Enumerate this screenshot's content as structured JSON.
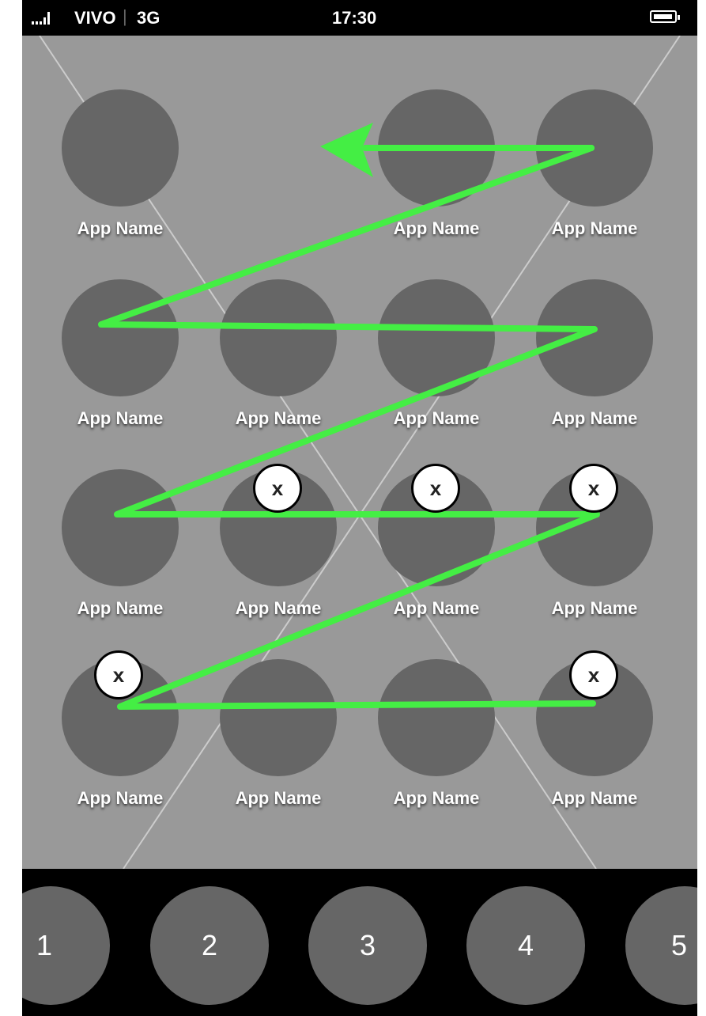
{
  "status_bar": {
    "carrier": "VIVO",
    "separator": "|",
    "network": "3G",
    "time": "17:30"
  },
  "apps": [
    {
      "label": "App Name"
    },
    {
      "label": "App Name"
    },
    {
      "label": "App Name"
    },
    {
      "label": "App Name"
    },
    {
      "label": "App Name"
    },
    {
      "label": "App Name"
    },
    {
      "label": "App Name"
    },
    {
      "label": "App Name"
    },
    {
      "label": "App Name"
    },
    {
      "label": "App Name"
    },
    {
      "label": "App Name"
    },
    {
      "label": "App Name"
    },
    {
      "label": "App Name"
    },
    {
      "label": "App Name"
    },
    {
      "label": "App Name"
    }
  ],
  "delete_badge_label": "x",
  "dock": {
    "pages": [
      "1",
      "2",
      "3",
      "4",
      "5"
    ]
  },
  "colors": {
    "background": "#999999",
    "icon": "#666666",
    "dock": "#000000",
    "gesture_path": "#44ee44",
    "badge": "#ffffff"
  },
  "icons": {
    "signal": "signal-strength-icon",
    "battery": "battery-icon",
    "gesture": "swipe-path-arrow-icon"
  }
}
